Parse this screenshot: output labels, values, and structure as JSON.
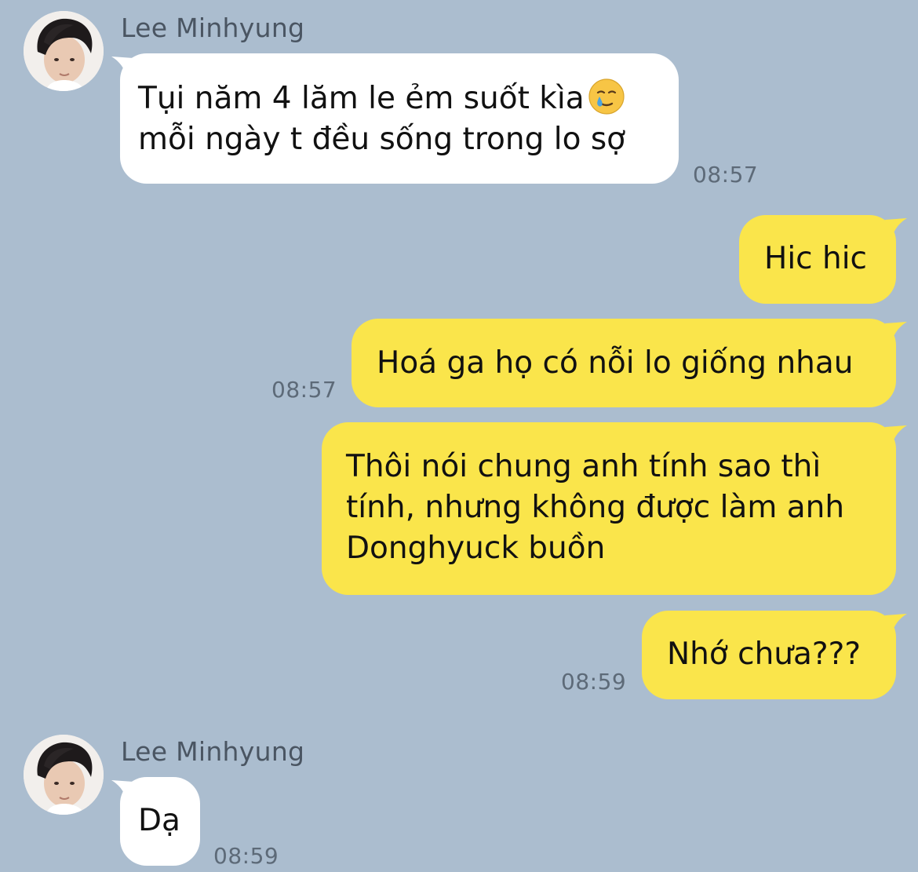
{
  "contact": {
    "name": "Lee Minhyung"
  },
  "messages": [
    {
      "lines": [
        "Tụi năm 4 lăm le ẻm suốt kìa",
        "mỗi ngày t đều sống trong lo sợ"
      ],
      "time": "08:57",
      "emoji": "crying-face-emoji"
    },
    {
      "text": "Hic hic"
    },
    {
      "text": "Hoá ga họ có nỗi lo giống nhau",
      "time": "08:57"
    },
    {
      "lines": [
        "Thôi nói chung anh tính sao thì",
        "tính, nhưng không được làm anh",
        "Donghyuck buồn"
      ]
    },
    {
      "text": "Nhớ chưa???",
      "time": "08:59"
    },
    {
      "text": "Dạ",
      "time": "08:59"
    }
  ],
  "colors": {
    "background": "#abbdcf",
    "incoming_bubble": "#ffffff",
    "outgoing_bubble": "#fae54b",
    "time_text": "#5d6a78"
  }
}
